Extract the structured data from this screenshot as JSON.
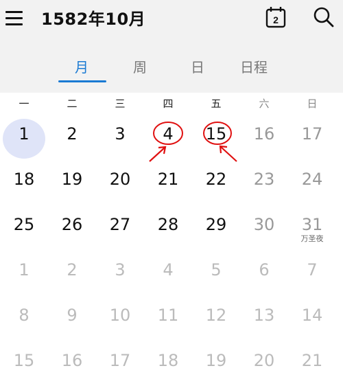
{
  "header": {
    "title": "1582年10月",
    "calendar_icon_day": "2"
  },
  "tabs": [
    {
      "label": "月",
      "active": true
    },
    {
      "label": "周",
      "active": false
    },
    {
      "label": "日",
      "active": false
    },
    {
      "label": "日程",
      "active": false
    }
  ],
  "weekdays": [
    "一",
    "二",
    "三",
    "四",
    "五",
    "六",
    "日"
  ],
  "weeks": [
    [
      {
        "n": "1",
        "today": true
      },
      {
        "n": "2"
      },
      {
        "n": "3"
      },
      {
        "n": "4",
        "circled": true
      },
      {
        "n": "15",
        "circled": true
      },
      {
        "n": "16"
      },
      {
        "n": "17"
      }
    ],
    [
      {
        "n": "18"
      },
      {
        "n": "19"
      },
      {
        "n": "20"
      },
      {
        "n": "21"
      },
      {
        "n": "22"
      },
      {
        "n": "23"
      },
      {
        "n": "24"
      }
    ],
    [
      {
        "n": "25"
      },
      {
        "n": "26"
      },
      {
        "n": "27"
      },
      {
        "n": "28"
      },
      {
        "n": "29"
      },
      {
        "n": "30"
      },
      {
        "n": "31",
        "sub": "万圣夜"
      }
    ],
    [
      {
        "n": "1",
        "other": true
      },
      {
        "n": "2",
        "other": true
      },
      {
        "n": "3",
        "other": true
      },
      {
        "n": "4",
        "other": true
      },
      {
        "n": "5",
        "other": true
      },
      {
        "n": "6",
        "other": true
      },
      {
        "n": "7",
        "other": true
      }
    ],
    [
      {
        "n": "8",
        "other": true
      },
      {
        "n": "9",
        "other": true
      },
      {
        "n": "10",
        "other": true
      },
      {
        "n": "11",
        "other": true
      },
      {
        "n": "12",
        "other": true
      },
      {
        "n": "13",
        "other": true
      },
      {
        "n": "14",
        "other": true
      }
    ],
    [
      {
        "n": "15",
        "other": true
      },
      {
        "n": "16",
        "other": true
      },
      {
        "n": "17",
        "other": true
      },
      {
        "n": "18",
        "other": true
      },
      {
        "n": "19",
        "other": true
      },
      {
        "n": "20",
        "other": true
      },
      {
        "n": "21",
        "other": true
      }
    ]
  ],
  "colors": {
    "accent": "#1a7ad3",
    "today_highlight": "#dfe4f8",
    "annotation": "#e01010"
  }
}
